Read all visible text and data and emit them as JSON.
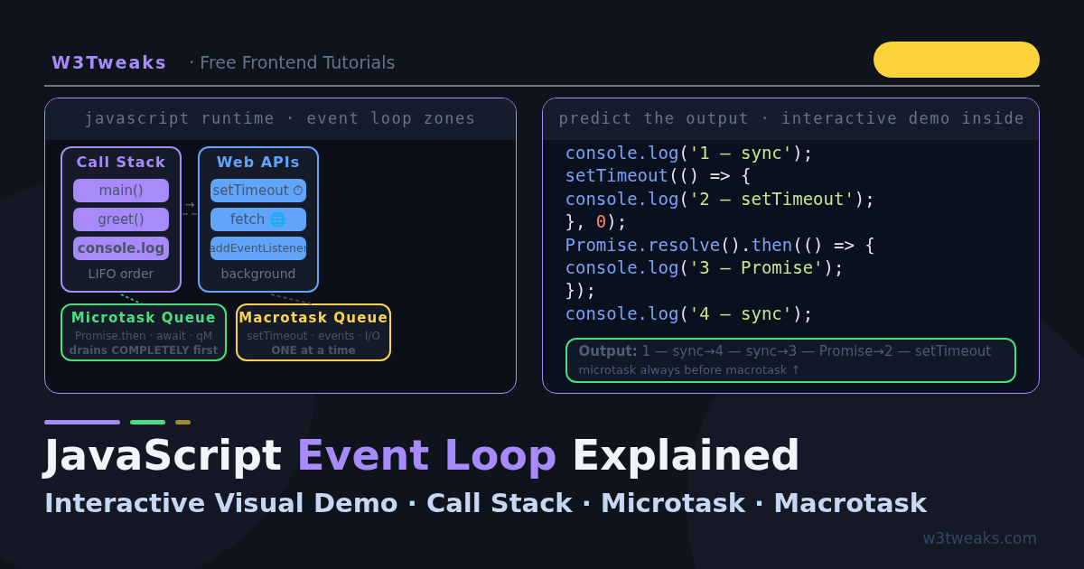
{
  "header": {
    "brand": "W3Tweaks",
    "tagline": "· Free Frontend Tutorials"
  },
  "runtime_panel": {
    "title": "javascript runtime · event loop zones",
    "call_stack": {
      "title": "Call Stack",
      "frames": [
        {
          "label": "main()",
          "bold": false
        },
        {
          "label": "greet()",
          "bold": false
        },
        {
          "label": "console.log",
          "bold": true
        }
      ],
      "note": "LIFO order"
    },
    "arrow": "→",
    "web_apis": {
      "title": "Web APIs",
      "items": [
        "setTimeout ⏱",
        "fetch 🌐",
        "addEventListener"
      ],
      "note": "background"
    },
    "queues": [
      {
        "title": "Microtask Queue",
        "color": "#4ade80",
        "line": "Promise.then · await · qM",
        "note": "drains COMPLETELY first"
      },
      {
        "title": "Macrotask Queue",
        "color": "#fcd34d",
        "line": "setTimeout · events · I/O",
        "note": "ONE at a time"
      }
    ]
  },
  "code_panel": {
    "title": "predict the output · interactive demo inside",
    "lines": [
      [
        {
          "kind": "fn",
          "text": "console.log"
        },
        {
          "kind": "punct",
          "text": "("
        },
        {
          "kind": "str",
          "text": "'1 — sync'"
        },
        {
          "kind": "punct",
          "text": ");"
        }
      ],
      [
        {
          "kind": "fn",
          "text": "setTimeout"
        },
        {
          "kind": "punct",
          "text": "(() => {"
        }
      ],
      [
        {
          "kind": "fn",
          "text": "console.log"
        },
        {
          "kind": "punct",
          "text": "("
        },
        {
          "kind": "str",
          "text": "'2 — setTimeout'"
        },
        {
          "kind": "punct",
          "text": ");"
        }
      ],
      [
        {
          "kind": "punct",
          "text": "}, "
        },
        {
          "kind": "num",
          "text": "0"
        },
        {
          "kind": "punct",
          "text": ");"
        }
      ],
      [
        {
          "kind": "fn",
          "text": "Promise.resolve"
        },
        {
          "kind": "punct",
          "text": "()."
        },
        {
          "kind": "fn",
          "text": "then"
        },
        {
          "kind": "punct",
          "text": "(() => {"
        }
      ],
      [
        {
          "kind": "fn",
          "text": "console.log"
        },
        {
          "kind": "punct",
          "text": "("
        },
        {
          "kind": "str",
          "text": "'3 — Promise'"
        },
        {
          "kind": "punct",
          "text": ");"
        }
      ],
      [
        {
          "kind": "punct",
          "text": "});"
        }
      ],
      [
        {
          "kind": "fn",
          "text": "console.log"
        },
        {
          "kind": "punct",
          "text": "("
        },
        {
          "kind": "str",
          "text": "'4 — sync'"
        },
        {
          "kind": "punct",
          "text": ");"
        }
      ]
    ],
    "output": {
      "text": "**Output:** 1 — sync→4 — sync→3 — Promise→2 — setTimeout",
      "note": "microtask always before macrotask ↑"
    }
  },
  "hero": {
    "accent_bars": [
      {
        "color": "#a78bfa"
      },
      {
        "color": "#4ade80"
      },
      {
        "color": "#a1883a"
      }
    ],
    "title": [
      {
        "kind": "plain",
        "text": "JavaScript "
      },
      {
        "kind": "accent",
        "text": "Event Loop"
      },
      {
        "kind": "plain",
        "text": " Explained"
      }
    ],
    "subtitle": "Interactive Visual Demo · Call Stack · Microtask · Macrotask",
    "site": "w3tweaks.com"
  }
}
